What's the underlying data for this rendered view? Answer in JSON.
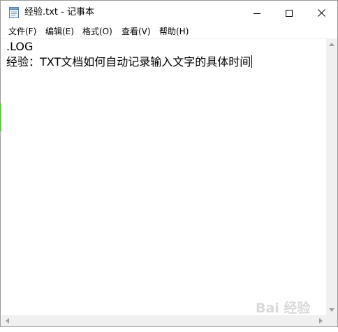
{
  "window": {
    "title": "经验.txt - 记事本"
  },
  "menu": {
    "file": "文件(F)",
    "edit": "编辑(E)",
    "format": "格式(O)",
    "view": "查看(V)",
    "help": "帮助(H)"
  },
  "editor": {
    "lines": [
      ".LOG",
      "经验：TXT文档如何自动记录输入文字的具体时间"
    ]
  },
  "watermark": {
    "text": "Bai 经验"
  },
  "colors": {
    "accent": "#6cc24a"
  }
}
